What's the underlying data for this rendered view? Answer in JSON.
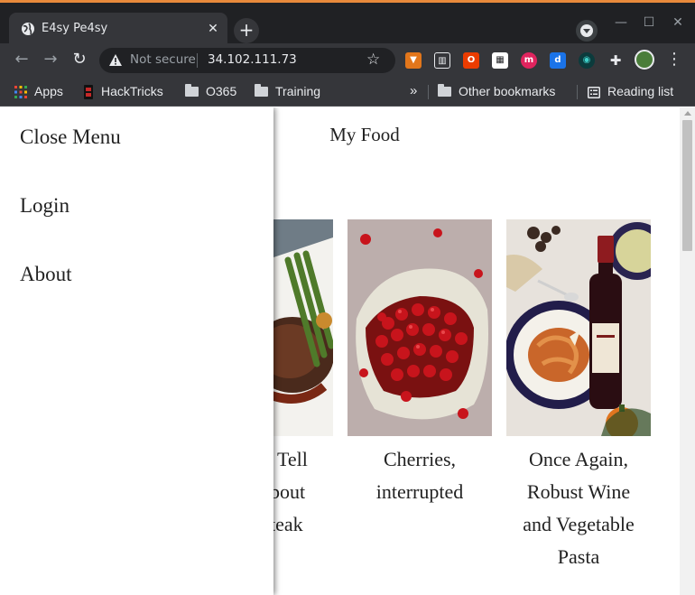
{
  "browser": {
    "tab_title": "E4sy Pe4sy",
    "security_label": "Not secure",
    "url": "34.102.111.73",
    "accent_color": "#e8893b",
    "bookmarks": [
      {
        "label": "Apps",
        "icon": "apps-grid-icon"
      },
      {
        "label": "HackTricks",
        "icon": "hacktricks-icon"
      },
      {
        "label": "O365",
        "icon": "folder-icon"
      },
      {
        "label": "Training",
        "icon": "folder-icon"
      }
    ],
    "bookmarks_overflow": "»",
    "other_bookmarks": "Other bookmarks",
    "reading_list": "Reading list"
  },
  "site": {
    "title": "My Food"
  },
  "menu": {
    "close": "Close Menu",
    "login": "Login",
    "about": "About"
  },
  "cards": [
    {
      "title_lines": [
        "Tell",
        "bout",
        "teak"
      ],
      "image": "steak-plate-photo"
    },
    {
      "title_lines": [
        "Cherries,",
        "interrupted"
      ],
      "image": "cherries-cloth-photo"
    },
    {
      "title_lines": [
        "Once Again,",
        "Robust Wine",
        "and Vegetable",
        "Pasta"
      ],
      "image": "wine-pasta-photo"
    }
  ]
}
